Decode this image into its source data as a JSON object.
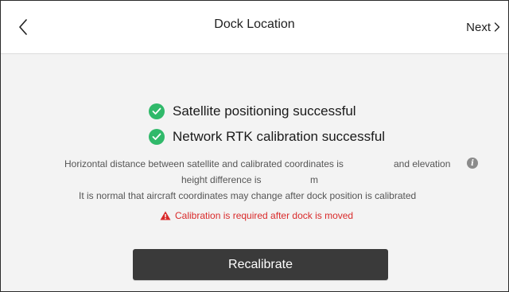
{
  "header": {
    "title": "Dock Location",
    "next_label": "Next"
  },
  "status": [
    {
      "label": "Satellite positioning successful"
    },
    {
      "label": "Network RTK calibration successful"
    }
  ],
  "description": {
    "line1_a": "Horizontal distance between satellite and calibrated coordinates is",
    "line1_b": "and elevation",
    "line2_a": "height difference is",
    "line2_b": "m",
    "line3": "It is normal that aircraft coordinates may change after dock position is calibrated"
  },
  "warning": {
    "text": "Calibration is required after dock is moved"
  },
  "actions": {
    "recalibrate_label": "Recalibrate"
  },
  "icons": {
    "back": "chevron-left-icon",
    "next": "chevron-right-icon",
    "check": "check-circle-icon",
    "info": "info-icon",
    "warning": "warning-triangle-icon"
  },
  "colors": {
    "success": "#30b96a",
    "warning": "#d92a2a",
    "button_bg": "#3a3a3a",
    "content_bg": "#f3f3f3"
  }
}
